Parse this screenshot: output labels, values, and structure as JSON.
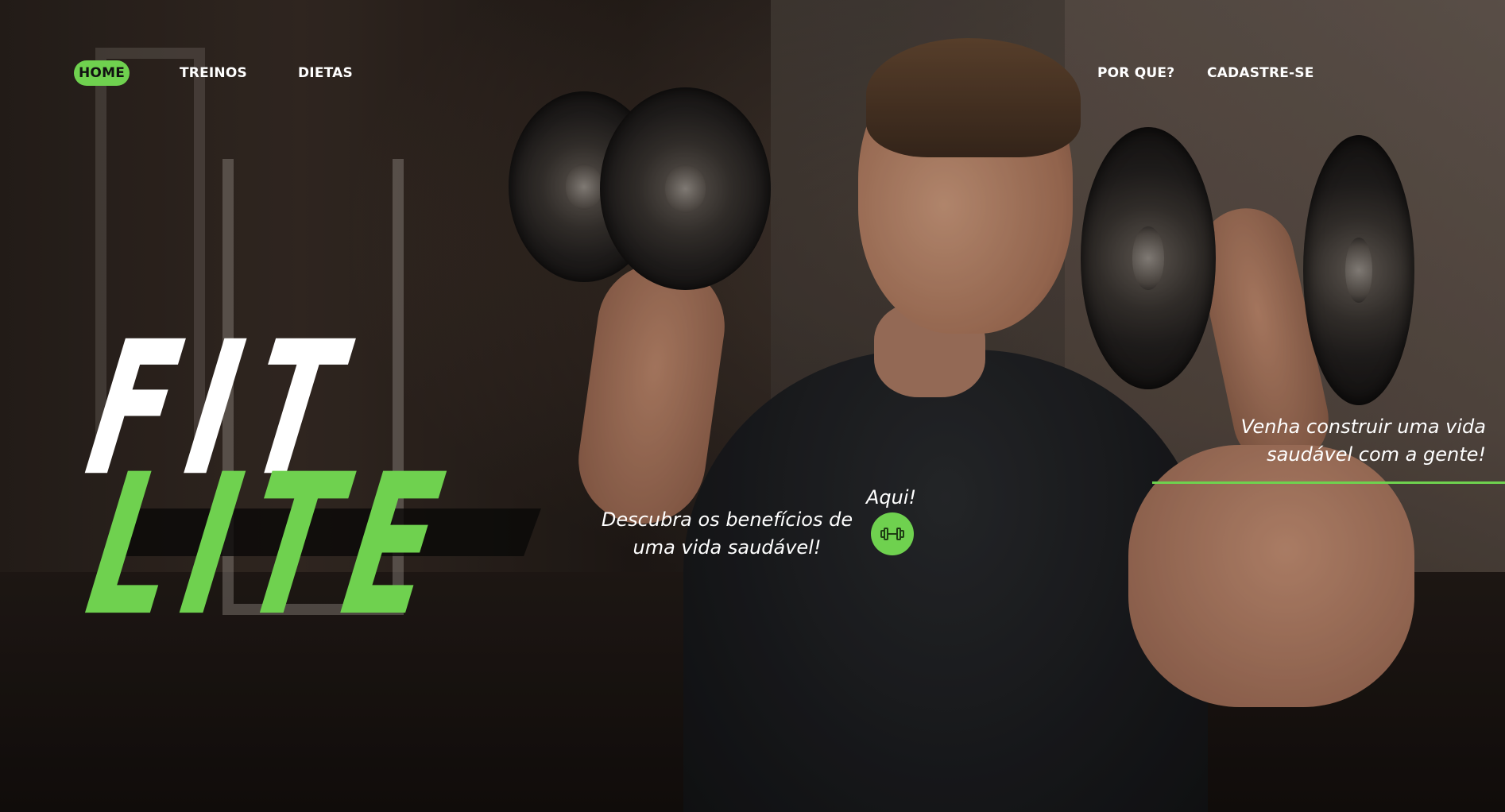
{
  "nav": {
    "left": [
      {
        "label": "HOME",
        "active": true
      },
      {
        "label": "TREINOS",
        "active": false
      },
      {
        "label": "DIETAS",
        "active": false
      }
    ],
    "right": [
      {
        "label": "POR QUE?"
      },
      {
        "label": "CADASTRE-SE"
      }
    ]
  },
  "logo": {
    "line1": "FIT",
    "line2": "LITE"
  },
  "cta": {
    "text": "Descubra os benefícios de uma vida saudável!",
    "button_label": "Aqui!",
    "button_icon": "dumbbell-icon"
  },
  "tagline": {
    "text": "Venha construir uma vida saudável com a gente!"
  },
  "colors": {
    "accent": "#6fd14f",
    "text": "#ffffff"
  }
}
